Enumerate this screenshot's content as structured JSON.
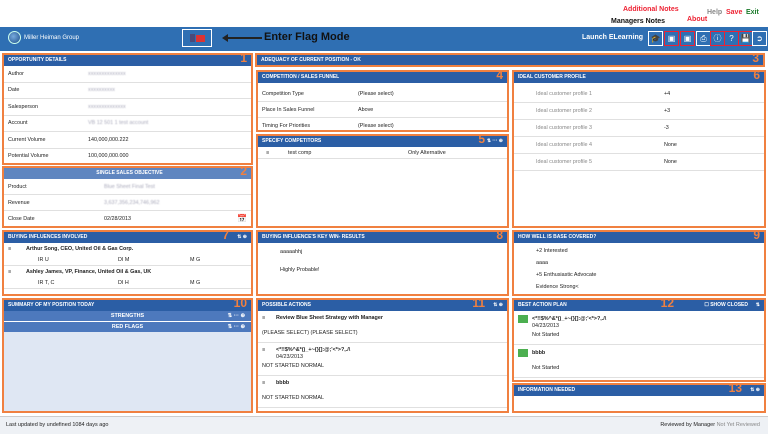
{
  "annotations": {
    "additional_notes": "Additional Notes",
    "managers_notes": "Managers Notes",
    "about": "About",
    "help": "Help",
    "save": "Save",
    "exit": "Exit",
    "enter_flag_mode": "Enter Flag Mode"
  },
  "header": {
    "logo_text": "Miller Heiman Group",
    "launch_elearning": "Launch ELearning"
  },
  "adequacy": {
    "title": "ADEQUACY OF CURRENT POSITION - OK",
    "num": "3"
  },
  "opportunity": {
    "title": "OPPORTUNITY DETAILS",
    "num": "1",
    "rows": [
      {
        "label": "Author",
        "value": "xxxxxxxxxxxxxx"
      },
      {
        "label": "Date",
        "value": "xxxxxxxxxx"
      },
      {
        "label": "Salesperson",
        "value": "xxxxxxxxxxxxxx"
      },
      {
        "label": "Account",
        "value": "VB 12 501 1 test account"
      },
      {
        "label": "Current Volume",
        "value": "140,000,000.222"
      },
      {
        "label": "Potential Volume",
        "value": "100,000,000.000"
      }
    ]
  },
  "single_sales": {
    "title": "SINGLE SALES OBJECTIVE",
    "num": "2",
    "rows": [
      {
        "label": "Product",
        "value": "Blue Sheet Final Test"
      },
      {
        "label": "Revenue",
        "value": "3,637,356,234,746,962"
      },
      {
        "label": "Close Date",
        "value": "02/28/2013"
      }
    ]
  },
  "competition": {
    "title": "COMPETITION / SALES FUNNEL",
    "num": "4",
    "rows": [
      {
        "label": "Competition Type",
        "value": "(Please select)"
      },
      {
        "label": "Place In Sales Funnel",
        "value": "Above"
      },
      {
        "label": "Timing For Priorities",
        "value": "(Please select)"
      }
    ]
  },
  "competitors": {
    "title": "SPECIFY COMPETITORS",
    "num": "5",
    "rows": [
      {
        "name": "test comp",
        "value": "Only Alternative"
      }
    ]
  },
  "ideal": {
    "title": "IDEAL CUSTOMER PROFILE",
    "num": "6",
    "rows": [
      {
        "label": "Ideal customer profile 1",
        "value": "+4"
      },
      {
        "label": "Ideal customer profile 2",
        "value": "+3"
      },
      {
        "label": "Ideal customer profile 3",
        "value": "-3"
      },
      {
        "label": "Ideal customer profile 4",
        "value": "None"
      },
      {
        "label": "Ideal customer profile 5",
        "value": "None"
      }
    ]
  },
  "buying": {
    "title": "BUYING INFLUENCES INVOLVED",
    "num": "7",
    "people": [
      {
        "name": "Arthur Song, CEO, United Oil & Gas Corp.",
        "a": "IR U",
        "b": "DI M",
        "c": "M G"
      },
      {
        "name": "Ashley James, VP, Finance, United Oil & Gas, UK",
        "a": "IR T, C",
        "b": "DI H",
        "c": "M G"
      }
    ]
  },
  "win_results": {
    "title": "BUYING INFLUENCE'S KEY WIN- RESULTS",
    "num": "8",
    "items": [
      "aaaaahhj",
      "Highly Probable!"
    ]
  },
  "base": {
    "title": "HOW WELL IS BASE COVERED?",
    "num": "9",
    "items": [
      "+2 Interested",
      "aaaa",
      "+5 Enthusiastic Advocate",
      "Evidence Strong<"
    ]
  },
  "summary": {
    "title": "SUMMARY OF MY POSITION TODAY",
    "num": "10",
    "strengths": "STRENGTHS",
    "red_flags": "RED FLAGS"
  },
  "actions": {
    "title": "POSSIBLE ACTIONS",
    "num": "11",
    "items": [
      {
        "title": "Review Blue Sheet Strategy with Manager",
        "sub": "(PLEASE SELECT)   (PLEASE SELECT)",
        "date": "",
        "status": ""
      },
      {
        "title": "<*!!$%^&*()_+~{}[]:@;'<*>?,./\\",
        "sub": "",
        "date": "04/23/2013",
        "status": "NOT STARTED   NORMAL"
      },
      {
        "title": "bbbb",
        "sub": "",
        "date": "",
        "status": "NOT STARTED   NORMAL"
      }
    ]
  },
  "best_action": {
    "title": "BEST ACTION PLAN",
    "num": "12",
    "show_closed": "SHOW CLOSED",
    "items": [
      {
        "title": "<*!!$%^&*()_+~{}[]:@;'<*>?,./\\",
        "date": "04/23/2013",
        "status": "Not Started"
      },
      {
        "title": "bbbb",
        "date": "",
        "status": "Not Started"
      }
    ]
  },
  "info_needed": {
    "title": "INFORMATION NEEDED",
    "num": "13"
  },
  "footer": {
    "last_updated": "Last updated by  undefined 1084 days ago",
    "reviewed_label": "Reviewed by Manager",
    "reviewed_value": "Not Yet Reviewed"
  }
}
